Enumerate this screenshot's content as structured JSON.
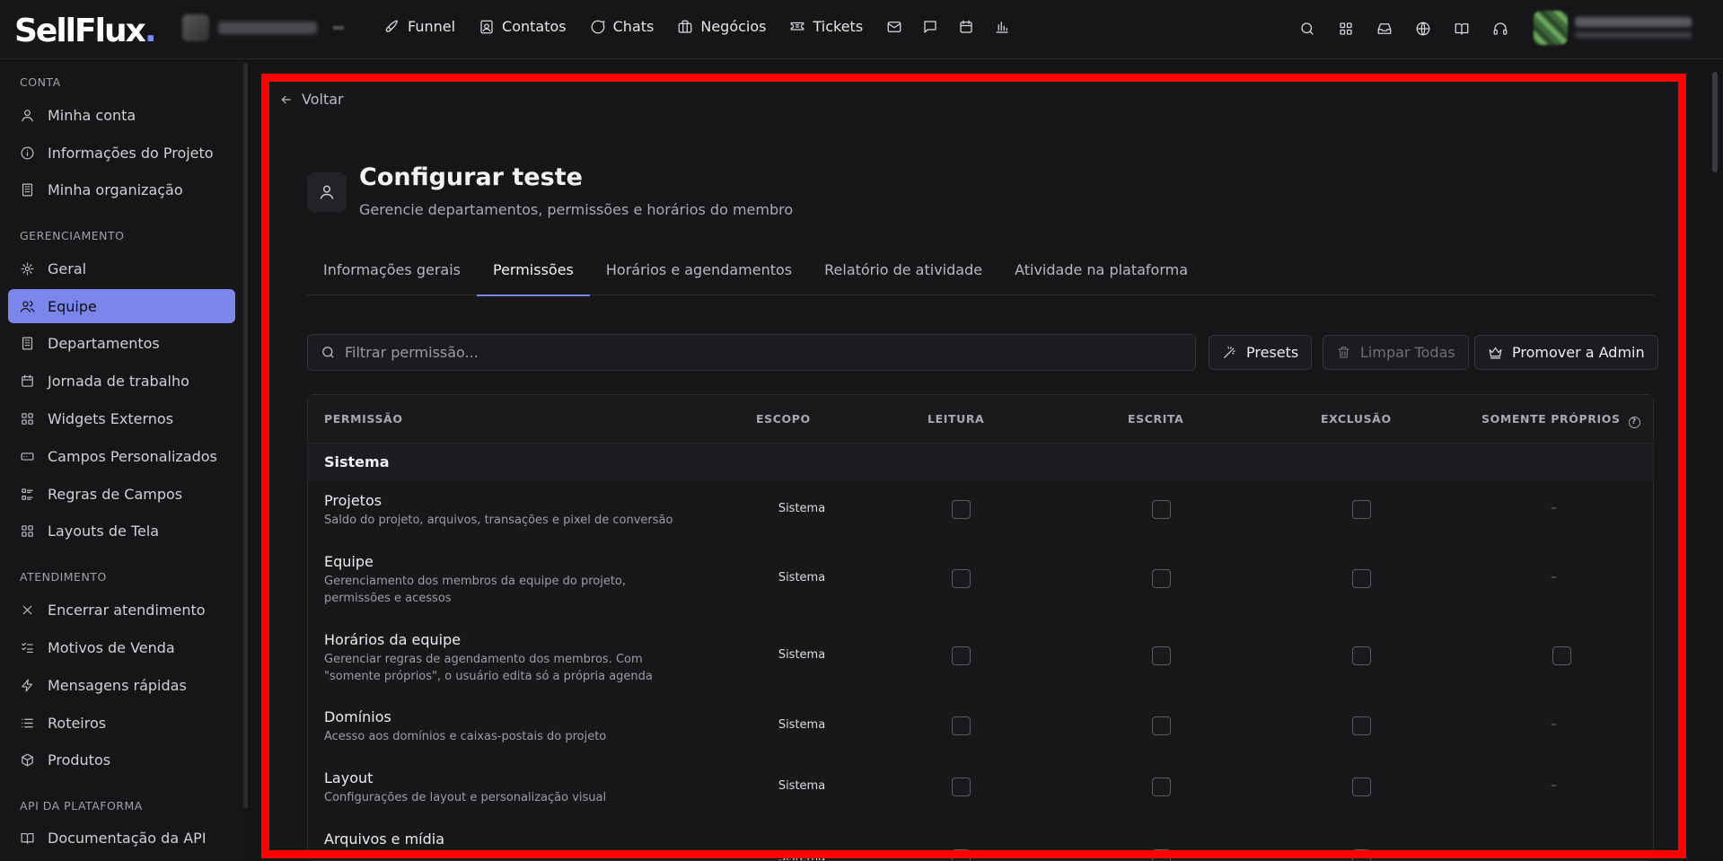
{
  "app": {
    "logo_text": "SellFlux",
    "logo_dot": "."
  },
  "topnav": {
    "items": [
      {
        "label": "Funnel",
        "icon": "rocket-icon"
      },
      {
        "label": "Contatos",
        "icon": "contacts-icon"
      },
      {
        "label": "Chats",
        "icon": "chat-icon"
      },
      {
        "label": "Negócios",
        "icon": "briefcase-icon"
      },
      {
        "label": "Tickets",
        "icon": "ticket-icon"
      }
    ],
    "icon_only": [
      "mail-icon",
      "message-square-icon",
      "calendar-icon",
      "bar-chart-icon"
    ],
    "right_icons": [
      "search-icon",
      "apps-icon",
      "inbox-icon",
      "globe-icon",
      "book-icon",
      "headset-icon"
    ]
  },
  "sidebar": {
    "sections": [
      {
        "title": "CONTA",
        "items": [
          {
            "label": "Minha conta",
            "icon": "user-icon"
          },
          {
            "label": "Informações do Projeto",
            "icon": "info-icon"
          },
          {
            "label": "Minha organização",
            "icon": "building-icon"
          }
        ]
      },
      {
        "title": "GERENCIAMENTO",
        "items": [
          {
            "label": "Geral",
            "icon": "gear-icon"
          },
          {
            "label": "Equipe",
            "icon": "users-icon",
            "active": true
          },
          {
            "label": "Departamentos",
            "icon": "building-icon"
          },
          {
            "label": "Jornada de trabalho",
            "icon": "calendar-icon"
          },
          {
            "label": "Widgets Externos",
            "icon": "grid-icon"
          },
          {
            "label": "Campos Personalizados",
            "icon": "input-icon"
          },
          {
            "label": "Regras de Campos",
            "icon": "rules-icon"
          },
          {
            "label": "Layouts de Tela",
            "icon": "layout-icon"
          }
        ]
      },
      {
        "title": "ATENDIMENTO",
        "items": [
          {
            "label": "Encerrar atendimento",
            "icon": "close-icon"
          },
          {
            "label": "Motivos de Venda",
            "icon": "checklist-icon"
          },
          {
            "label": "Mensagens rápidas",
            "icon": "zap-icon"
          },
          {
            "label": "Roteiros",
            "icon": "list-icon"
          },
          {
            "label": "Produtos",
            "icon": "box-icon"
          }
        ]
      },
      {
        "title": "API DA PLATAFORMA",
        "items": [
          {
            "label": "Documentação da API",
            "icon": "book-icon"
          }
        ]
      }
    ]
  },
  "page": {
    "back_label": "Voltar",
    "title": "Configurar teste",
    "subtitle": "Gerencie departamentos, permissões e horários do membro",
    "tabs": [
      {
        "label": "Informações gerais"
      },
      {
        "label": "Permissões",
        "active": true
      },
      {
        "label": "Horários e agendamentos"
      },
      {
        "label": "Relatório de atividade"
      },
      {
        "label": "Atividade na plataforma"
      }
    ],
    "filter_placeholder": "Filtrar permissão...",
    "buttons": {
      "presets": "Presets",
      "clear_all": "Limpar Todas",
      "promote": "Promover a Admin"
    }
  },
  "table": {
    "headers": {
      "permission": "PERMISSÃO",
      "scope": "ESCOPO",
      "read": "LEITURA",
      "write": "ESCRITA",
      "delete": "EXCLUSÃO",
      "own_only": "SOMENTE PRÓPRIOS"
    },
    "group": "Sistema",
    "rows": [
      {
        "name": "Projetos",
        "desc": "Saldo do projeto, arquivos, transações e pixel de conversão",
        "scope": "Sistema",
        "read": false,
        "write": false,
        "delete": false,
        "own_only": "–"
      },
      {
        "name": "Equipe",
        "desc": "Gerenciamento dos membros da equipe do projeto, permissões e acessos",
        "scope": "Sistema",
        "read": false,
        "write": false,
        "delete": false,
        "own_only": "–"
      },
      {
        "name": "Horários da equipe",
        "desc": "Gerenciar regras de agendamento dos membros. Com \"somente próprios\", o usuário edita só a própria agenda (aba...",
        "scope": "Sistema",
        "read": false,
        "write": false,
        "delete": false,
        "own_only": "checkbox"
      },
      {
        "name": "Domínios",
        "desc": "Acesso aos domínios e caixas-postais do projeto",
        "scope": "Sistema",
        "read": false,
        "write": false,
        "delete": false,
        "own_only": "–"
      },
      {
        "name": "Layout",
        "desc": "Configurações de layout e personalização visual",
        "scope": "Sistema",
        "read": false,
        "write": false,
        "delete": false,
        "own_only": "–"
      },
      {
        "name": "Arquivos e mídia",
        "desc": "",
        "scope": "Sistema",
        "read": false,
        "write": false,
        "delete": false,
        "own_only": "–"
      }
    ]
  },
  "colors": {
    "accent": "#7a86ea",
    "highlight_frame": "#ff0000",
    "background": "#141416"
  }
}
